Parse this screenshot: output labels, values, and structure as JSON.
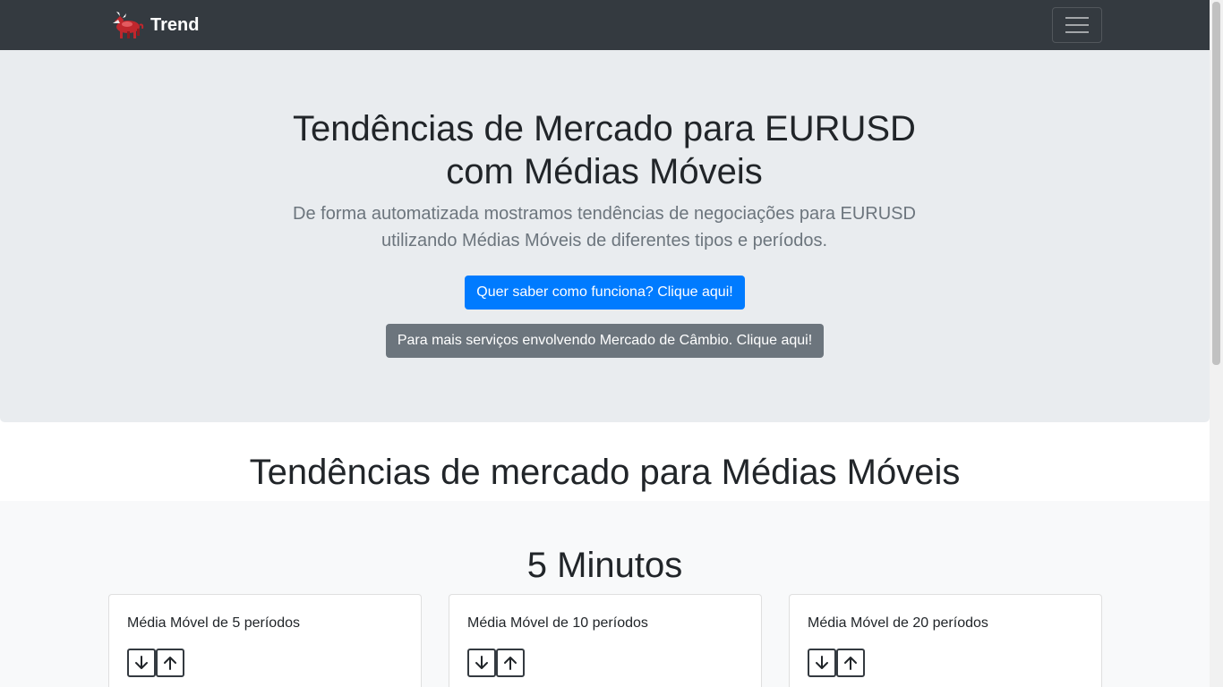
{
  "navbar": {
    "brand": "Trend",
    "brand_icon": "bull-icon",
    "menu_icon": "hamburger-menu-icon"
  },
  "hero": {
    "title": "Tendências de Mercado para EURUSD com Médias Móveis",
    "lead": "De forma automatizada mostramos tendências de negociações para EURUSD utilizando Médias Móveis de diferentes tipos e períodos.",
    "primary_button": "Quer saber como funciona? Clique aqui!",
    "secondary_button": "Para mais serviços envolvendo Mercado de Câmbio. Clique aqui!"
  },
  "section_title": "Tendências de mercado para Médias Móveis",
  "timeframe": {
    "title": "5 Minutos",
    "cards": [
      {
        "title": "Média Móvel de 5 períodos"
      },
      {
        "title": "Média Móvel de 10 períodos"
      },
      {
        "title": "Média Móvel de 20 períodos"
      }
    ]
  },
  "colors": {
    "navbar_bg": "#343a40",
    "jumbotron_bg": "#e9ecef",
    "primary": "#007bff",
    "secondary": "#6c757d",
    "section_bg": "#f8f9fa",
    "logo_accent": "#c0272d"
  }
}
